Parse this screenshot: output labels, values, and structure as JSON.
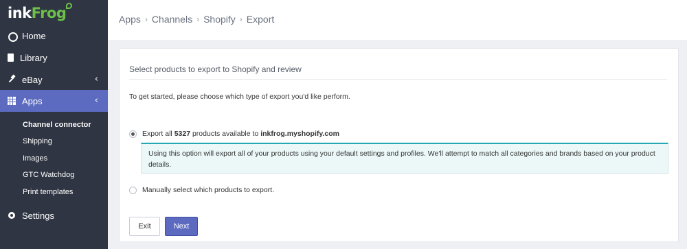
{
  "brand": {
    "part1": "ink",
    "part2": "Frog"
  },
  "sidebar": {
    "items": [
      {
        "label": "Home",
        "icon": "home-icon"
      },
      {
        "label": "Library",
        "icon": "document-icon"
      },
      {
        "label": "eBay",
        "icon": "hammer-icon",
        "chevron": "‹"
      },
      {
        "label": "Apps",
        "icon": "grid-icon",
        "chevron": "‹",
        "active": true
      },
      {
        "label": "Settings",
        "icon": "gear-icon"
      }
    ],
    "subitems": [
      "Channel connector",
      "Shipping",
      "Images",
      "GTC Watchdog",
      "Print templates"
    ]
  },
  "breadcrumb": {
    "items": [
      "Apps",
      "Channels",
      "Shopify",
      "Export"
    ],
    "separator": "›"
  },
  "card": {
    "title": "Select products to export to Shopify and review",
    "intro": "To get started, please choose which type of export you'd like perform.",
    "option_all": {
      "prefix": "Export all ",
      "count": "5327",
      "middle": " products available to ",
      "store": "inkfrog.myshopify.com",
      "selected": true
    },
    "info_text": "Using this option will export all of your products using your default settings and profiles. We'll attempt to match all categories and brands based on your product details.",
    "option_manual": {
      "label": "Manually select which products to export.",
      "selected": false
    }
  },
  "buttons": {
    "exit": "Exit",
    "next": "Next"
  },
  "colors": {
    "sidebar_bg": "#2f3542",
    "accent": "#5c6bc0",
    "info_border": "#26a7b4",
    "brand_green": "#6cc04a"
  }
}
